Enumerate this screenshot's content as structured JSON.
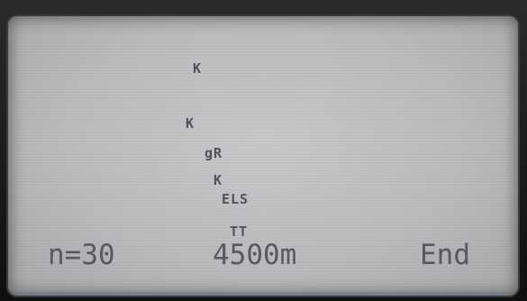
{
  "display": {
    "markers": {
      "k1": "K",
      "k2": "K",
      "gr": "gR",
      "k3": "K",
      "els": "ELS",
      "tt": "TT"
    },
    "status": {
      "count": "n=30",
      "depth": "4500m",
      "end": "End"
    }
  }
}
